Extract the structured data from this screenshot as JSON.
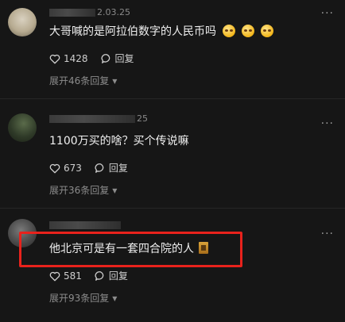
{
  "comments": [
    {
      "date_suffix": "2.03.25",
      "text": "大哥喊的是阿拉伯数字的人民币吗",
      "emojis": [
        "grimace-emoji",
        "grimace-emoji",
        "grimace-emoji"
      ],
      "likes": "1428",
      "reply_label": "回复",
      "expand_replies": "展开46条回复"
    },
    {
      "date_suffix": "25",
      "text": "1100万买的啥？买个传说嘛",
      "likes": "673",
      "reply_label": "回复",
      "expand_replies": "展开36条回复"
    },
    {
      "date_suffix": "",
      "text": "他北京可是有一套四合院的人",
      "emojis": [
        "house-emoji"
      ],
      "likes": "581",
      "reply_label": "回复",
      "expand_replies": "展开93条回复"
    }
  ],
  "more_menu_icon": "ellipsis-icon",
  "highlight_color": "#e8221c"
}
